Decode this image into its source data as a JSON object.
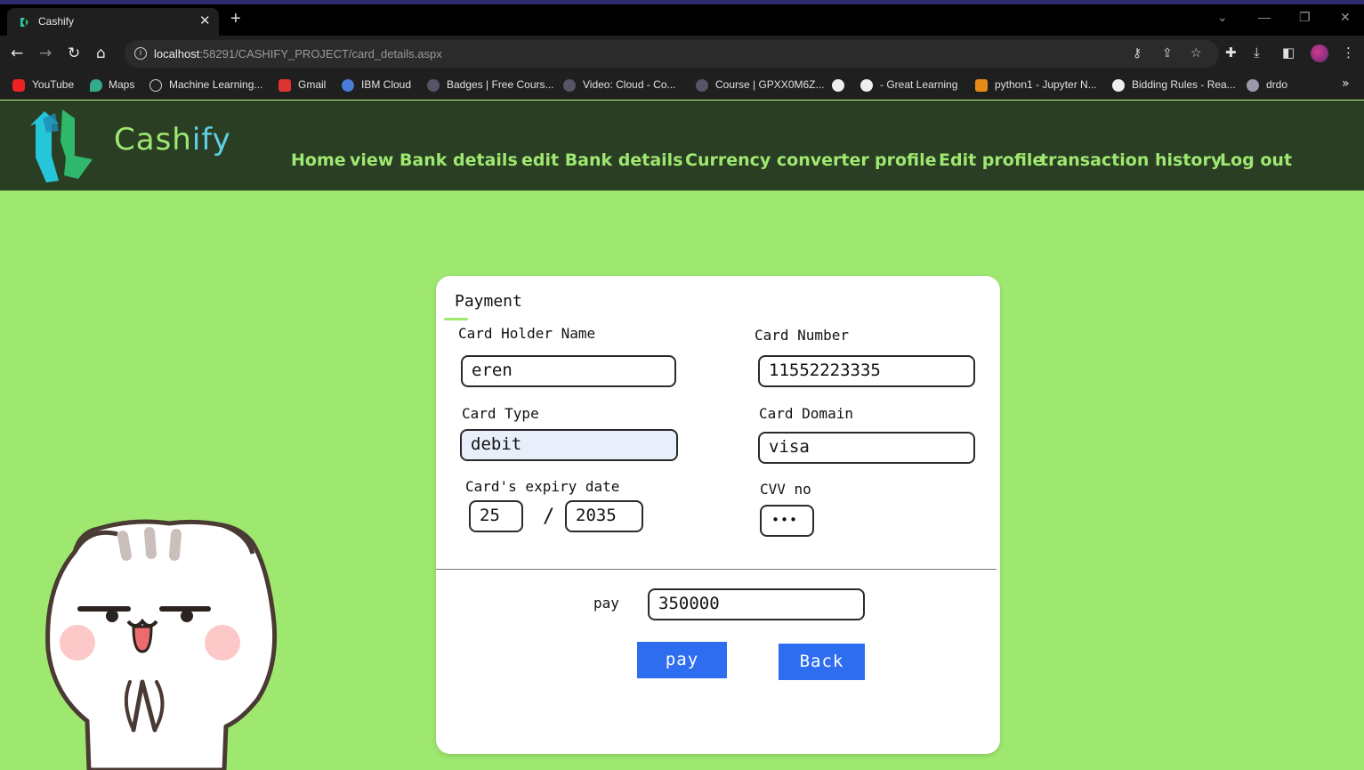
{
  "browser": {
    "tab_title": "Cashify",
    "tab_close": "✕",
    "new_tab": "+",
    "url_host": "localhost",
    "url_rest": ":58291/CASHIFY_PROJECT/card_details.aspx",
    "bookmarks": [
      "YouTube",
      "Maps",
      "Machine Learning...",
      "Gmail",
      "IBM Cloud",
      "Badges | Free Cours...",
      "Video: Cloud - Co...",
      "Course | GPXX0M6Z...",
      "- Great Learning",
      "python1 - Jupyter N...",
      "Bidding Rules - Rea...",
      "drdo"
    ],
    "colors": {
      "tabstrip": "#000000",
      "toolbar": "#1f1f1f"
    }
  },
  "site": {
    "logo": {
      "cash": "Cash",
      "ify": "ify"
    },
    "nav": {
      "home": "Home",
      "view_bank": "view Bank details",
      "edit_bank": "edit Bank details",
      "currency": "Currency converter",
      "profile": "profile",
      "edit_profile": "Edit profile",
      "transaction_history": "transaction history",
      "logout": "Log out"
    },
    "colors": {
      "header_bg": "#2a3e24",
      "page_bg": "#9fe870",
      "accent": "#9fe870",
      "button": "#2f6df0"
    }
  },
  "payment": {
    "title": "Payment",
    "card_holder_label": "Card Holder Name",
    "card_holder_value": "eren",
    "card_number_label": "Card Number",
    "card_number_value": "11552223335",
    "card_type_label": "Card Type",
    "card_type_value": "debit",
    "card_domain_label": "Card Domain",
    "card_domain_value": "visa",
    "expiry_label": "Card's expiry date",
    "expiry_month": "25",
    "expiry_separator": "/",
    "expiry_year": "2035",
    "cvv_label": "CVV no",
    "cvv_value": "•••",
    "pay_label": "pay",
    "pay_amount": "350000",
    "pay_button": "pay",
    "back_button": "Back"
  }
}
